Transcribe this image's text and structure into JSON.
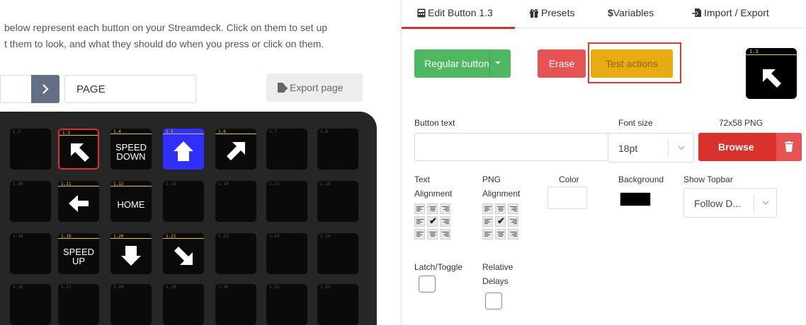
{
  "intro": {
    "line1": "below represent each button on your Streamdeck. Click on them to set up",
    "line2": "t them to look, and what they should do when you press or click on them."
  },
  "pager": {
    "page_name": "PAGE",
    "export_label": "Export page"
  },
  "deck": {
    "rows": [
      [
        {
          "label": "1.2",
          "topbar": false
        },
        {
          "label": "1.3",
          "topbar": true,
          "icon": "arrow-up-left-icon",
          "selected": true
        },
        {
          "label": "1.4",
          "topbar": true,
          "text": "SPEED\nDOWN"
        },
        {
          "label": "1.5",
          "topbar": true,
          "icon": "arrow-up-icon",
          "bg": "#2f2fff"
        },
        {
          "label": "1.6",
          "topbar": true,
          "icon": "arrow-up-right-icon"
        },
        {
          "label": "1.7",
          "topbar": false
        },
        {
          "label": "1.8",
          "topbar": false
        }
      ],
      [
        {
          "label": "1.10",
          "topbar": false
        },
        {
          "label": "1.11",
          "topbar": true,
          "icon": "arrow-left-icon"
        },
        {
          "label": "1.12",
          "topbar": true,
          "text": "HOME"
        },
        {
          "label": "1.13",
          "topbar": false
        },
        {
          "label": "1.14",
          "topbar": false
        },
        {
          "label": "1.15",
          "topbar": false
        },
        {
          "label": "1.16",
          "topbar": false
        }
      ],
      [
        {
          "label": "1.18",
          "topbar": false
        },
        {
          "label": "1.19",
          "topbar": true,
          "text": "SPEED\nUP"
        },
        {
          "label": "1.20",
          "topbar": true,
          "icon": "arrow-down-icon"
        },
        {
          "label": "1.21",
          "topbar": true,
          "icon": "arrow-down-right-icon"
        },
        {
          "label": "1.22",
          "topbar": false
        },
        {
          "label": "1.23",
          "topbar": false
        },
        {
          "label": "1.24",
          "topbar": false
        }
      ],
      [
        {
          "label": "1.26",
          "topbar": false
        },
        {
          "label": "1.27",
          "topbar": false
        },
        {
          "label": "1.28",
          "topbar": false
        },
        {
          "label": "1.29",
          "topbar": false
        },
        {
          "label": "1.30",
          "topbar": false
        },
        {
          "label": "1.31",
          "topbar": false
        },
        {
          "label": "1.32",
          "topbar": false
        }
      ]
    ]
  },
  "tabs": {
    "edit": "Edit Button 1.3",
    "presets": "Presets",
    "variables": "Variables",
    "import_export": "Import / Export"
  },
  "actions": {
    "regular": "Regular button",
    "erase": "Erase",
    "test": "Test actions"
  },
  "preview": {
    "label": "1.3",
    "icon": "arrow-up-left-icon"
  },
  "form": {
    "button_text_label": "Button text",
    "button_text_value": "",
    "font_size_label": "Font size",
    "font_size_value": "18pt",
    "png_label": "72x58 PNG",
    "browse": "Browse",
    "text_align_label_1": "Text",
    "text_align_label_2": "Alignment",
    "png_align_label_1": "PNG",
    "png_align_label_2": "Alignment",
    "color_label": "Color",
    "background_label": "Background",
    "show_topbar_label": "Show Topbar",
    "show_topbar_value": "Follow D...",
    "latch_label": "Latch/Toggle",
    "relative_label_1": "Relative",
    "relative_label_2": "Delays"
  },
  "colors": {
    "text_color": "#ffffff",
    "background_color": "#000000",
    "accent_red": "#d9312b",
    "success_green": "#4db860",
    "warning_yellow": "#e8ac10"
  }
}
